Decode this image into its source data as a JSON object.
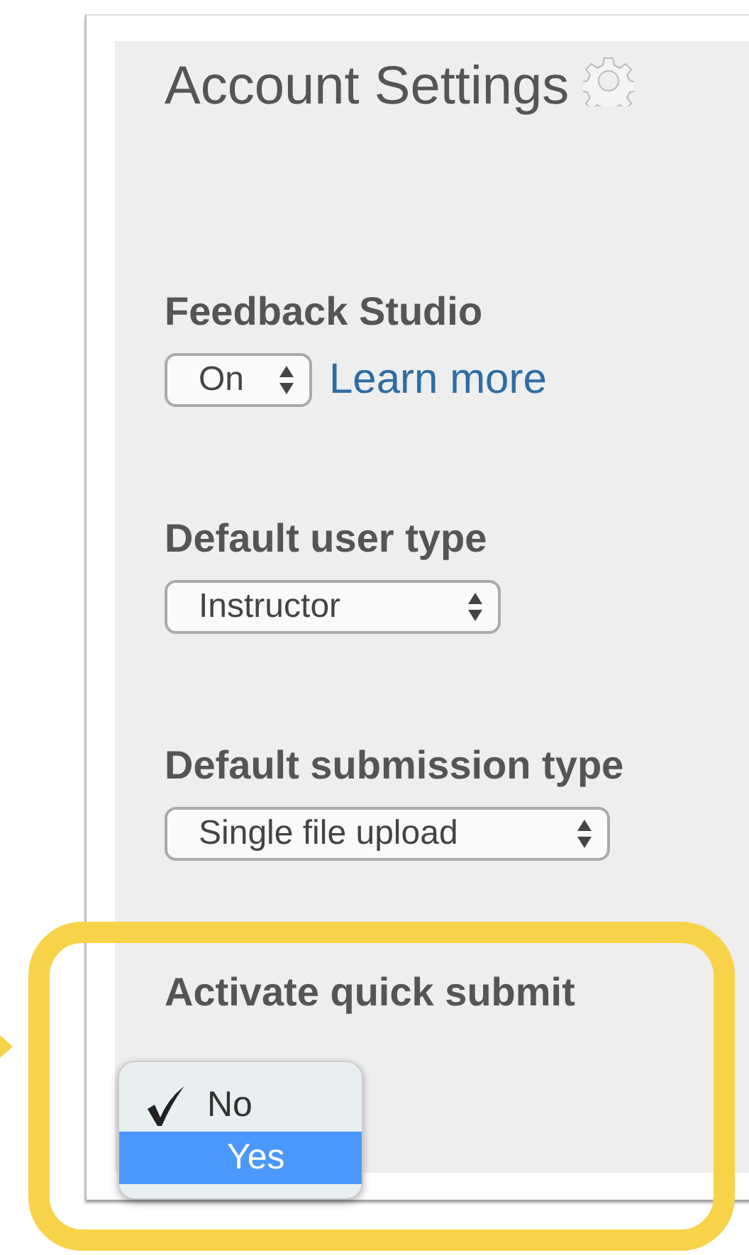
{
  "title": "Account Settings",
  "fields": [
    {
      "label": "Feedback Studio",
      "kind": "select",
      "value": "On",
      "link": "Learn more"
    },
    {
      "label": "Default user type",
      "kind": "select",
      "value": "Instructor"
    },
    {
      "label": "Default submission type",
      "kind": "select",
      "value": "Single file upload"
    },
    {
      "label": "Activate quick submit",
      "kind": "menu",
      "options": [
        {
          "label": "No",
          "checked": true,
          "selected": false
        },
        {
          "label": "Yes",
          "checked": false,
          "selected": true
        }
      ]
    }
  ]
}
